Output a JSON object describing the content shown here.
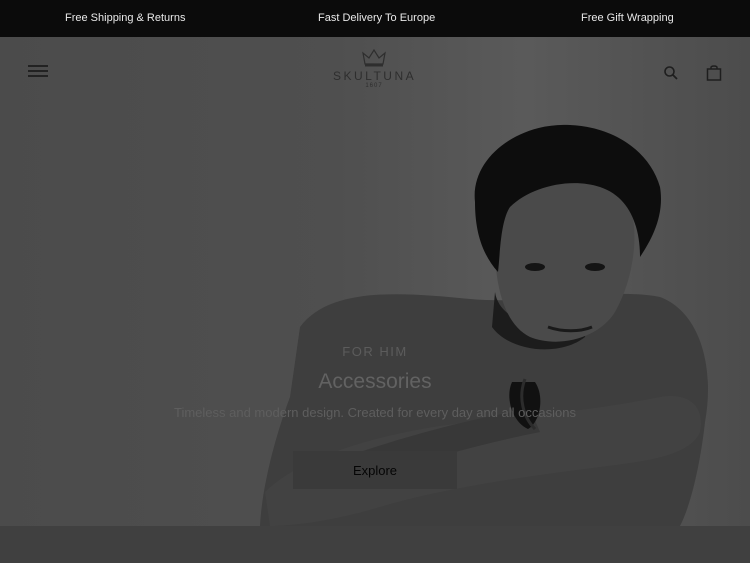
{
  "announcements": {
    "shipping": "Free Shipping & Returns",
    "delivery": "Fast Delivery To Europe",
    "gift": "Free Gift Wrapping"
  },
  "header": {
    "brand": "SKULTUNA",
    "established": "1607",
    "menu_icon": "hamburger-menu-icon",
    "search_icon": "search-icon",
    "bag_icon": "shopping-bag-icon"
  },
  "hero": {
    "eyebrow": "FOR HIM",
    "headline": "Accessories",
    "tagline": "Timeless and modern design. Created for every day and all occasions",
    "cta_label": "Explore"
  },
  "colors": {
    "announcement_bar": "#0b0b0b",
    "overlay": "#3b3b3b",
    "cta_background": "#3a3a3a"
  }
}
